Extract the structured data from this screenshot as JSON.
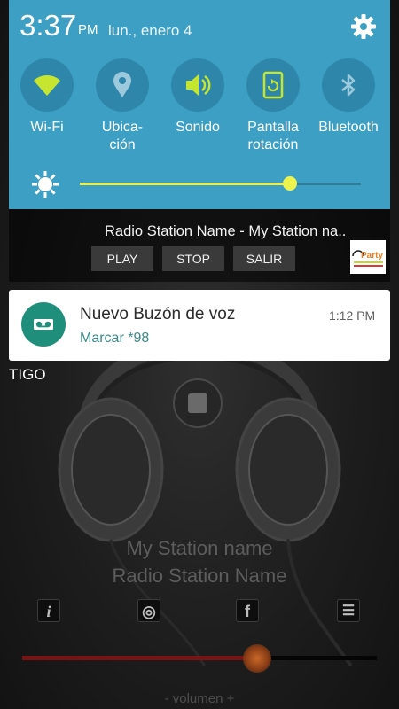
{
  "status": {
    "time": "3:37",
    "ampm": "PM",
    "date": "lun., enero 4"
  },
  "quick_settings": {
    "toggles": [
      {
        "label": "Wi-Fi",
        "icon": "wifi-icon",
        "active": true
      },
      {
        "label": "Ubica-\nción",
        "icon": "location-icon",
        "active": false
      },
      {
        "label": "Sonido",
        "icon": "sound-icon",
        "active": true
      },
      {
        "label": "Pantalla\nrotación",
        "icon": "screen-rotation-icon",
        "active": true
      },
      {
        "label": "Bluetooth",
        "icon": "bluetooth-icon",
        "active": false
      }
    ],
    "brightness_level": 0.75,
    "colors": {
      "panel": "#3d9fc4",
      "accent": "#e6f24a"
    }
  },
  "media_notification": {
    "title": "Radio Station Name - My Station na..",
    "buttons": [
      "PLAY",
      "STOP",
      "SALIR"
    ],
    "logo_text": "Party"
  },
  "voicemail_notification": {
    "title": "Nuevo Buzón de voz",
    "subtitle": "Marcar *98",
    "time": "1:12 PM"
  },
  "app": {
    "carrier": "TIGO",
    "station_name": "My Station name",
    "radio_name": "Radio Station Name",
    "controls": [
      {
        "icon": "info-icon",
        "glyph": "i"
      },
      {
        "icon": "globe-icon",
        "glyph": "◎"
      },
      {
        "icon": "facebook-icon",
        "glyph": "f"
      },
      {
        "icon": "menu-icon",
        "glyph": "☰"
      }
    ],
    "volume_level": 0.66,
    "volume_label": "- volumen +"
  }
}
